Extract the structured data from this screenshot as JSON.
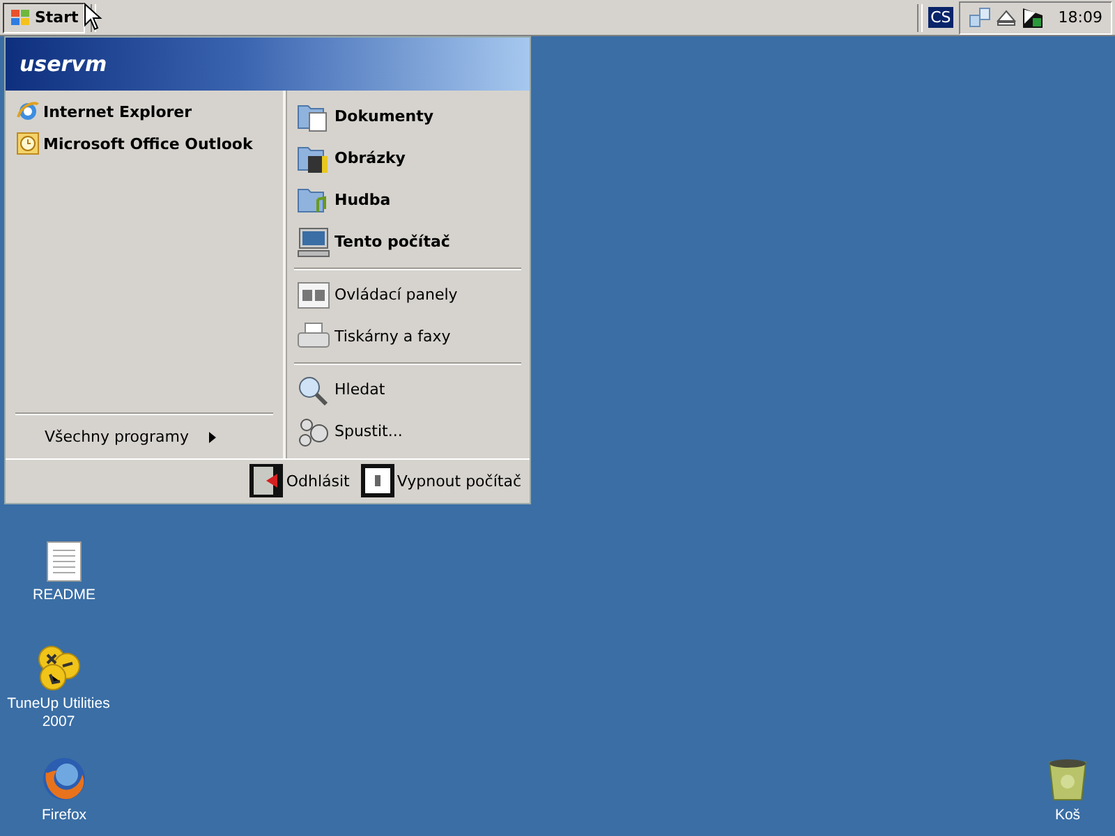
{
  "taskbar": {
    "start_button": {
      "label": "Start",
      "pressed": true
    },
    "language": "CS",
    "clock": "18:09"
  },
  "start_menu": {
    "user": "uservm",
    "pinned": [
      {
        "kind": "browser",
        "label": "Internet Explorer"
      },
      {
        "kind": "mail",
        "label": "Microsoft Office Outlook"
      }
    ],
    "all_programs": "Všechny programy",
    "places": [
      {
        "emphasis": true,
        "items": [
          {
            "kind": "documents",
            "label": "Dokumenty"
          },
          {
            "kind": "pictures",
            "label": "Obrázky"
          },
          {
            "kind": "music",
            "label": "Hudba"
          },
          {
            "kind": "computer",
            "label": "Tento počítač"
          }
        ]
      },
      {
        "emphasis": false,
        "items": [
          {
            "kind": "control",
            "label": "Ovládací panely"
          },
          {
            "kind": "printer",
            "label": "Tiskárny a faxy"
          }
        ]
      },
      {
        "emphasis": false,
        "items": [
          {
            "kind": "search",
            "label": "Hledat"
          },
          {
            "kind": "run",
            "label": "Spustit..."
          }
        ]
      }
    ],
    "footer": [
      {
        "kind": "logoff",
        "label": "Odhlásit"
      },
      {
        "kind": "shutdown",
        "label": "Vypnout počítač"
      }
    ]
  },
  "desktop_icons": [
    {
      "kind": "document",
      "label": "README"
    },
    {
      "kind": "tools",
      "label": "TuneUp Utilities 2007"
    },
    {
      "kind": "firefox",
      "label": "Firefox"
    },
    {
      "kind": "recycle",
      "label": "Koš"
    }
  ]
}
